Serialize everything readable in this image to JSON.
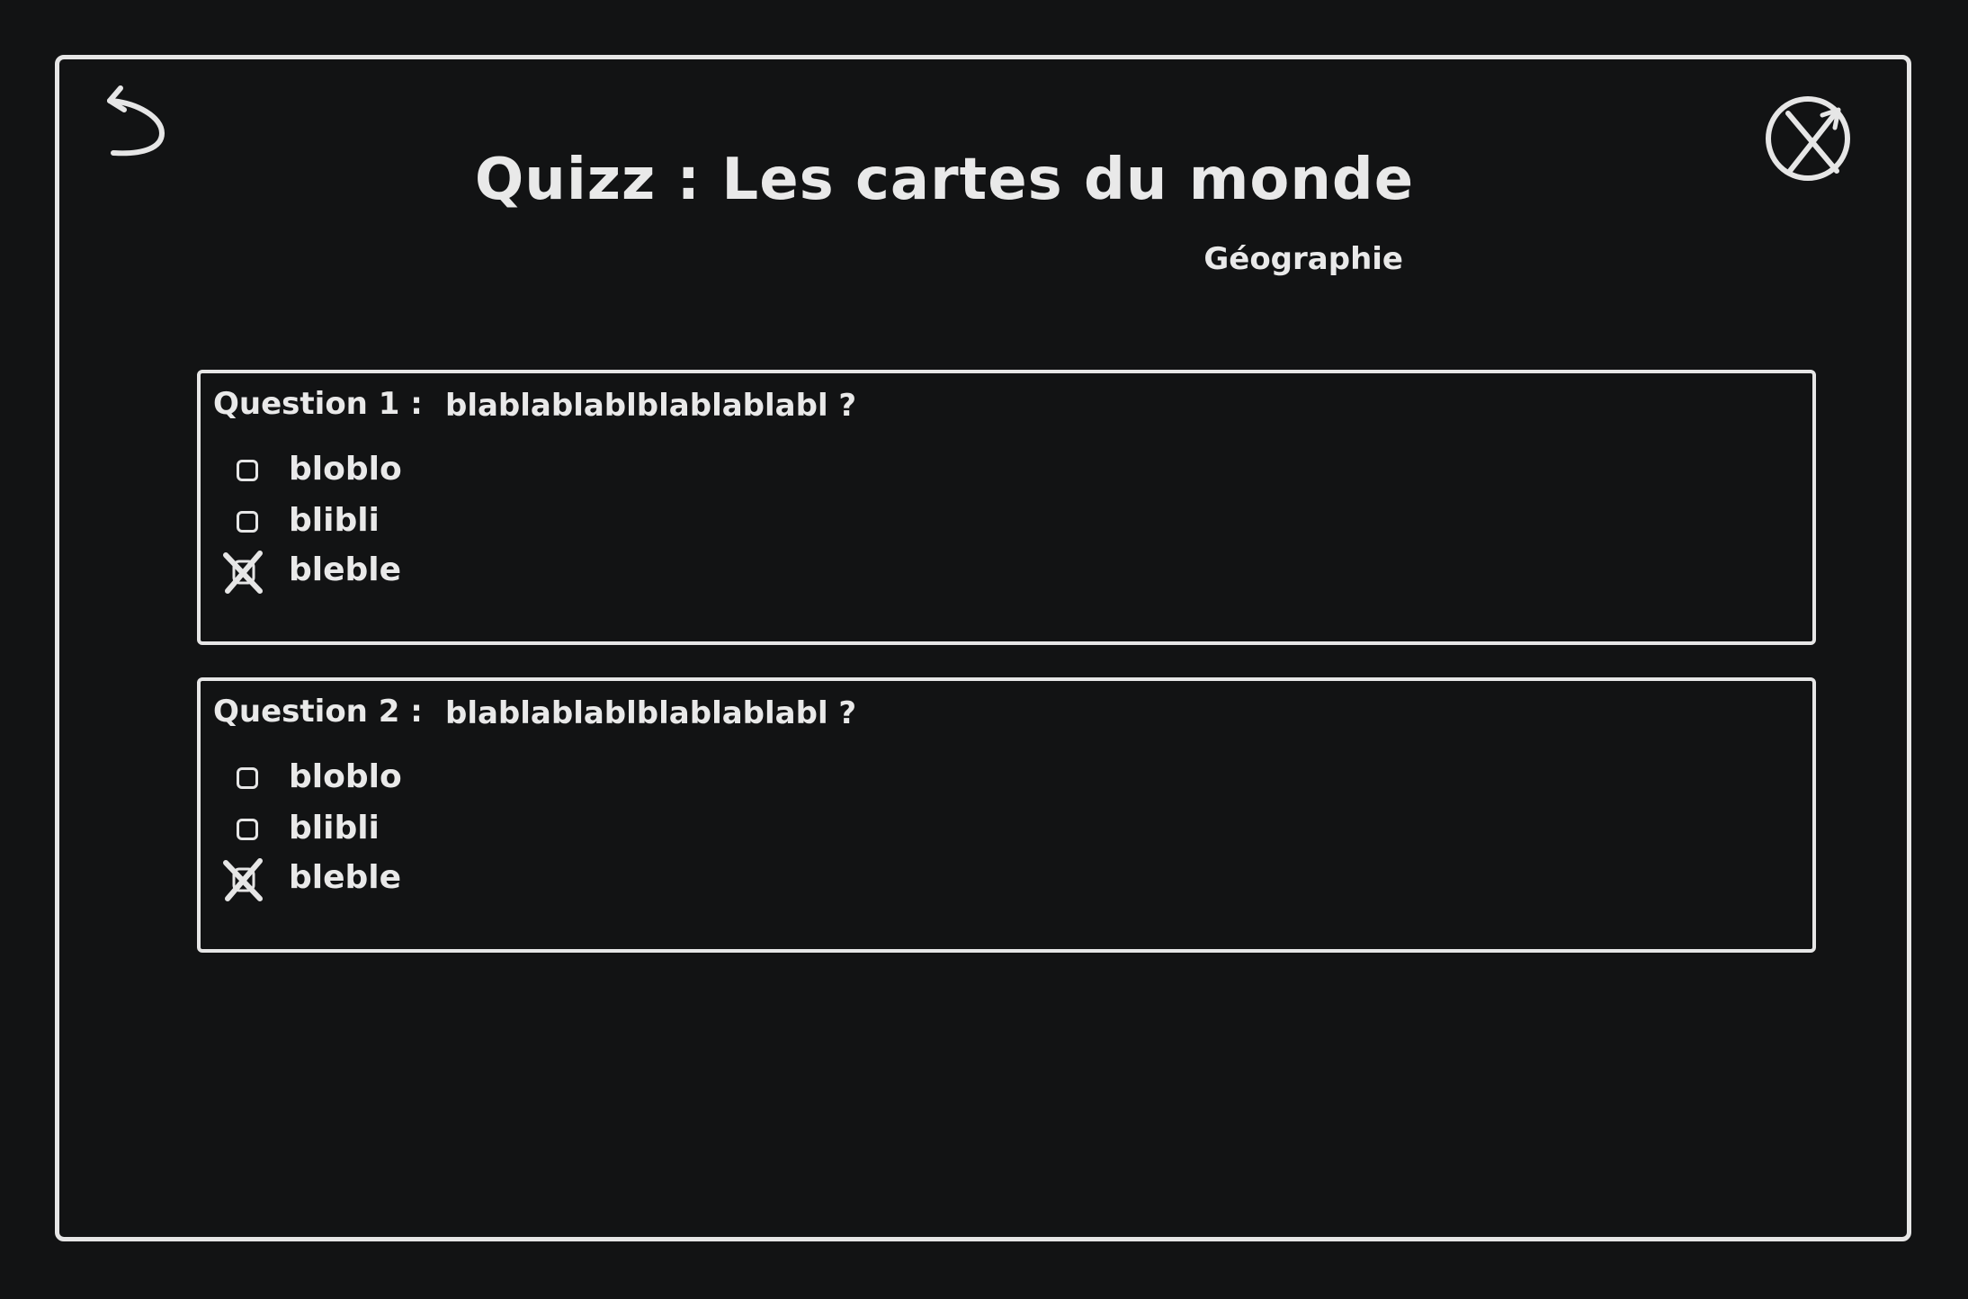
{
  "app": {
    "title": "Quizz : Les cartes du monde",
    "subtitle": "Géographie"
  },
  "toolbar": {
    "back_icon": "undo-arrow-icon",
    "close_icon": "close-circle-icon"
  },
  "questions": [
    {
      "label": "Question 1 :",
      "text": "blablablablblablablabl ?",
      "options": [
        {
          "label": "bloblo",
          "checked": false
        },
        {
          "label": "blibli",
          "checked": false
        },
        {
          "label": "bleble",
          "checked": true
        }
      ]
    },
    {
      "label": "Question 2 :",
      "text": "blablablablblablablabl ?",
      "options": [
        {
          "label": "bloblo",
          "checked": false
        },
        {
          "label": "blibli",
          "checked": false
        },
        {
          "label": "bleble",
          "checked": true
        }
      ]
    }
  ],
  "colors": {
    "background": "#121314",
    "foreground": "#e6e6e6"
  }
}
